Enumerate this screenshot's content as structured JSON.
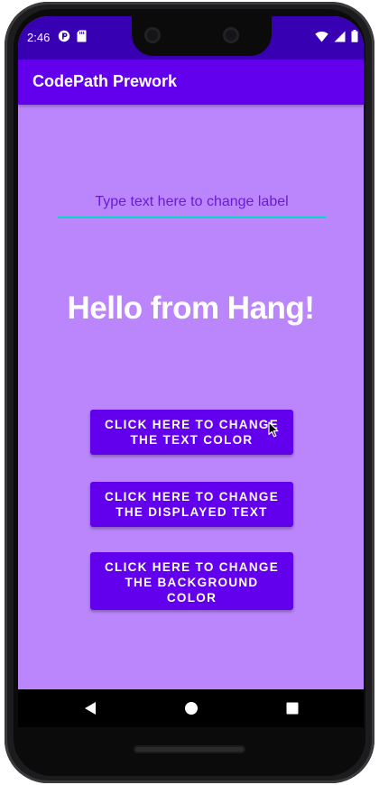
{
  "status_bar": {
    "time": "2:46",
    "left_icons": [
      "app-notification-icon",
      "sd-card-icon"
    ],
    "right_icons": [
      "wifi-icon",
      "signal-icon",
      "battery-icon"
    ]
  },
  "app_bar": {
    "title": "CodePath Prework"
  },
  "label_input": {
    "placeholder": "Type text here to change label",
    "value": ""
  },
  "label": {
    "text": "Hello from Hang!"
  },
  "buttons": {
    "text_color": "CLICK HERE TO CHANGE\nTHE TEXT COLOR",
    "displayed_text": "CLICK HERE TO CHANGE\nTHE DISPLAYED TEXT",
    "background_color": "CLICK HERE TO CHANGE\nTHE BACKGROUND\nCOLOR"
  },
  "nav_bar": {
    "icons": [
      "back-icon",
      "home-icon",
      "recents-icon"
    ]
  },
  "colors": {
    "status_bar": "#3700b3",
    "app_bar": "#6200ee",
    "background": "#bb86fc",
    "button": "#6200ee",
    "input_underline": "#03dac5",
    "label_text": "#ffffff"
  }
}
